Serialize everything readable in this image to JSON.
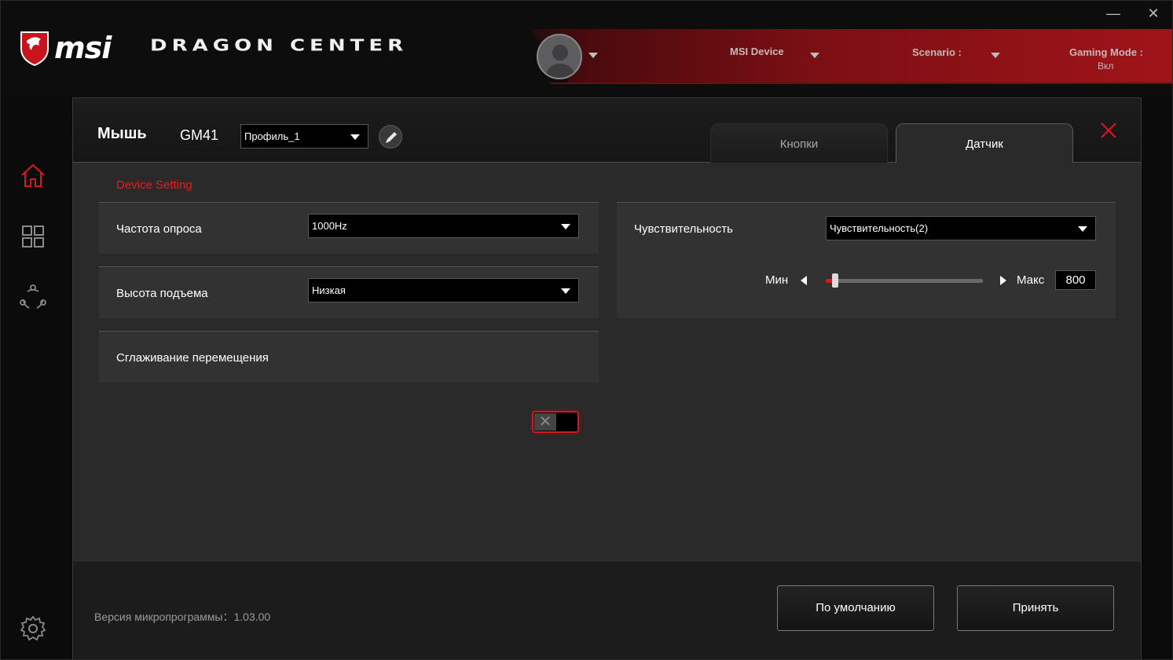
{
  "app": {
    "brand": "msi",
    "product": "DRAGON CENTER"
  },
  "header": {
    "msi_device_label": "MSI Device",
    "scenario_label": "Scenario :",
    "gaming_mode_label": "Gaming Mode :",
    "gaming_mode_value": "Вкл",
    "accent_color": "#a01419"
  },
  "window": {
    "minimize_glyph": "—",
    "close_glyph": "✕"
  },
  "sidebar": {
    "items": [
      {
        "icon": "home-icon",
        "active": true
      },
      {
        "icon": "grid-icon",
        "active": false
      },
      {
        "icon": "share-icon",
        "active": false
      },
      {
        "icon": "settings-gear-icon",
        "active": false
      }
    ]
  },
  "dialog": {
    "title": "Мышь",
    "model": "GM41",
    "profile_value": "Профиль_1",
    "tabs": [
      {
        "label": "Кнопки",
        "active": false
      },
      {
        "label": "Датчик",
        "active": true
      }
    ],
    "section_title": "Device Setting",
    "settings": {
      "polling_rate": {
        "label": "Частота опроса",
        "value": "1000Hz"
      },
      "lift_height": {
        "label": "Высота подъема",
        "value": "Низкая"
      },
      "smoothing": {
        "label": "Сглаживание перемещения",
        "enabled": false
      }
    },
    "sensitivity": {
      "label": "Чувствительность",
      "value": "Чувствительность(2)",
      "min_label": "Мин",
      "max_label": "Макс",
      "dpi_value": "800",
      "slider_fraction": 0.04
    },
    "footer": {
      "firmware_version": "Версия микропрограммы：1.03.00",
      "default_button": "По умолчанию",
      "apply_button": "Принять"
    }
  }
}
